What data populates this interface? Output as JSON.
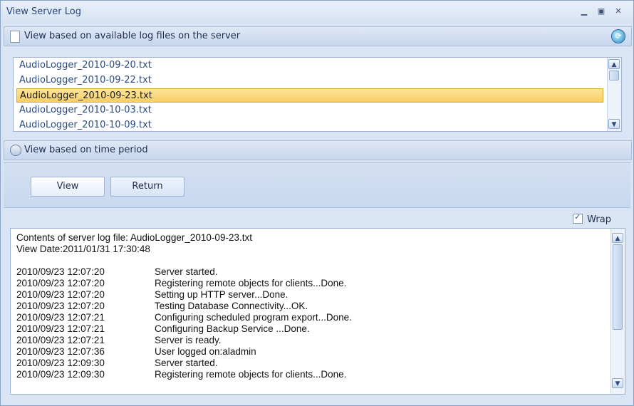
{
  "window": {
    "title": "View Server Log",
    "controls": [
      "minimize",
      "maximize",
      "close"
    ]
  },
  "sections": {
    "log_files": {
      "label": "View based on available log files on the server",
      "icon": "document-icon",
      "refresh_icon": "refresh-icon"
    },
    "time_period": {
      "label": "View based on time period",
      "icon": "clock-icon"
    }
  },
  "file_list": {
    "items": [
      "AudioLogger_2010-09-20.txt",
      "AudioLogger_2010-09-22.txt",
      "AudioLogger_2010-09-23.txt",
      "AudioLogger_2010-10-03.txt",
      "AudioLogger_2010-10-09.txt"
    ],
    "selected_index": 2
  },
  "buttons": {
    "view": "View",
    "return": "Return"
  },
  "wrap": {
    "label": "Wrap",
    "checked": true
  },
  "log": {
    "header": [
      "Contents of server log file: AudioLogger_2010-09-23.txt",
      "View Date:2011/01/31 17:30:48"
    ],
    "entries": [
      {
        "time": "2010/09/23 12:07:20",
        "message": "Server started."
      },
      {
        "time": "2010/09/23 12:07:20",
        "message": "Registering remote objects for clients...Done."
      },
      {
        "time": "2010/09/23 12:07:20",
        "message": "Setting up HTTP server...Done."
      },
      {
        "time": "2010/09/23 12:07:20",
        "message": "Testing Database Connectivity...OK."
      },
      {
        "time": "2010/09/23 12:07:21",
        "message": "Configuring scheduled program export...Done."
      },
      {
        "time": "2010/09/23 12:07:21",
        "message": "Configuring Backup Service ...Done."
      },
      {
        "time": "2010/09/23 12:07:21",
        "message": "Server is ready."
      },
      {
        "time": "2010/09/23 12:07:36",
        "message": "User logged on:aladmin"
      },
      {
        "time": "2010/09/23 12:09:30",
        "message": "Server started."
      },
      {
        "time": "2010/09/23 12:09:30",
        "message": "Registering remote objects for clients...Done."
      }
    ]
  },
  "colors": {
    "selection": "#f8ce66",
    "accent": "#25457a",
    "panel": "#d9e4f4"
  }
}
